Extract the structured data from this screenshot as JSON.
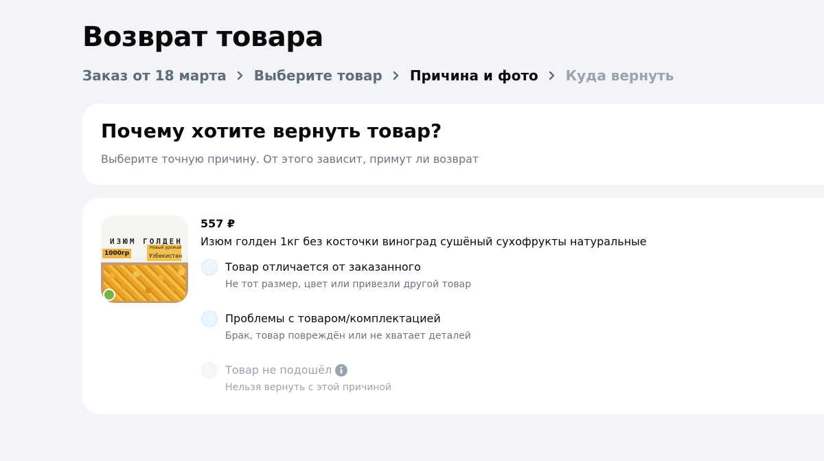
{
  "page": {
    "title": "Возврат товара"
  },
  "breadcrumb": {
    "step1": "Заказ от 18 марта",
    "step2": "Выберите товар",
    "step3": "Причина и фото",
    "step4": "Куда вернуть"
  },
  "question": {
    "title": "Почему хотите вернуть товар?",
    "subtitle": "Выберите точную причину. От этого зависит, примут ли возврат"
  },
  "product": {
    "price": "557 ₽",
    "name": "Изюм голден 1кг без косточки виноград сушёный сухофрукты натуральные",
    "image_text": {
      "name": "ИЗЮМ ГОЛДЕН",
      "weight": "1000гр",
      "tag_small": "Новый урожай",
      "tag_country": "Узбекистан"
    }
  },
  "options": [
    {
      "label": "Товар отличается от заказанного",
      "description": "Не тот размер, цвет или привезли другой товар",
      "enabled": true
    },
    {
      "label": "Проблемы с товаром/комплектацией",
      "description": "Брак, товар повреждён или не хватает деталей",
      "enabled": true
    },
    {
      "label": "Товар не подошёл",
      "description": "Нельзя вернуть с этой причиной",
      "enabled": false
    }
  ],
  "colors": {
    "background": "#f2f4f8",
    "card": "#ffffff",
    "text_primary": "#0a0a0a",
    "text_secondary": "#6b7480",
    "text_disabled": "#9aa3ae",
    "radio_fill": "#eef6fd"
  },
  "icons": {
    "separator": "chevron-right-icon",
    "info": "info-icon",
    "badge": "leaf-badge-icon"
  }
}
